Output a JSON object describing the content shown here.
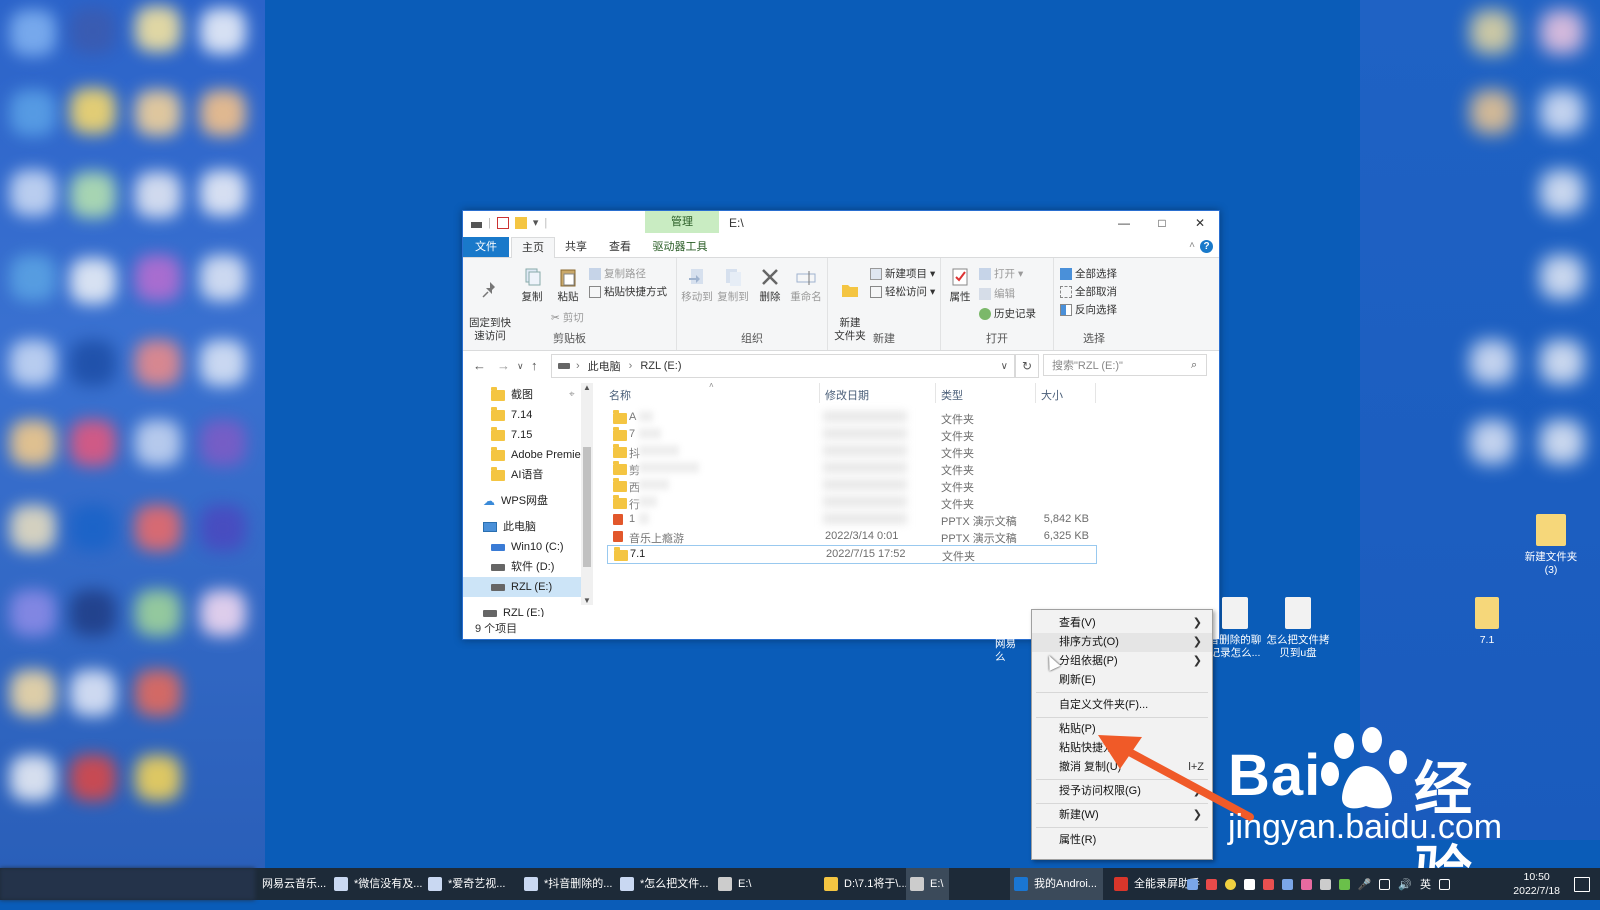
{
  "window": {
    "title": "E:\\",
    "context_tab": "管理",
    "tabs": [
      "文件",
      "主页",
      "共享",
      "查看",
      "驱动器工具"
    ],
    "help_label": "?"
  },
  "ribbon": {
    "clipboard": {
      "label": "剪贴板",
      "pin": "固定到快\n速访问",
      "copy": "复制",
      "paste": "粘贴",
      "copy_path": "复制路径",
      "paste_shortcut": "粘贴快捷方式",
      "cut": "剪切"
    },
    "organize": {
      "label": "组织",
      "move_to": "移动到",
      "copy_to": "复制到",
      "delete": "删除",
      "rename": "重命名"
    },
    "new": {
      "label": "新建",
      "new_folder": "新建\n文件夹",
      "new_item": "新建项目",
      "easy_access": "轻松访问"
    },
    "open": {
      "label": "打开",
      "properties": "属性",
      "open": "打开",
      "edit": "编辑",
      "history": "历史记录"
    },
    "select": {
      "label": "选择",
      "select_all": "全部选择",
      "select_none": "全部取消",
      "invert": "反向选择"
    }
  },
  "address": {
    "crumbs": [
      "此电脑",
      "RZL (E:)"
    ],
    "search_placeholder": "搜索\"RZL (E:)\""
  },
  "nav": {
    "items": [
      {
        "label": "截图",
        "kind": "folder"
      },
      {
        "label": "7.14",
        "kind": "folder"
      },
      {
        "label": "7.15",
        "kind": "folder"
      },
      {
        "label": "Adobe Premier",
        "kind": "folder"
      },
      {
        "label": "AI语音",
        "kind": "folder"
      },
      {
        "label": "WPS网盘",
        "kind": "cloud"
      },
      {
        "label": "此电脑",
        "kind": "pc"
      },
      {
        "label": "Win10 (C:)",
        "kind": "drive"
      },
      {
        "label": "软件 (D:)",
        "kind": "drive"
      },
      {
        "label": "RZL (E:)",
        "kind": "drive"
      },
      {
        "label": "RZL (E:)",
        "kind": "drive"
      }
    ]
  },
  "columns": {
    "name": "名称",
    "date": "修改日期",
    "type": "类型",
    "size": "大小"
  },
  "files": [
    {
      "name": "A",
      "date": "",
      "type": "文件夹",
      "size": "",
      "icon": "folder"
    },
    {
      "name": "7",
      "date": "",
      "type": "文件夹",
      "size": "",
      "icon": "folder"
    },
    {
      "name": "抖",
      "date": "",
      "type": "文件夹",
      "size": "",
      "icon": "folder"
    },
    {
      "name": "剪",
      "date": "",
      "type": "文件夹",
      "size": "",
      "icon": "folder"
    },
    {
      "name": "西",
      "date": "",
      "type": "文件夹",
      "size": "",
      "icon": "folder"
    },
    {
      "name": "行",
      "date": "",
      "type": "文件夹",
      "size": "",
      "icon": "folder"
    },
    {
      "name": "1",
      "date": "",
      "type": "PPTX 演示文稿",
      "size": "5,842 KB",
      "icon": "pptx"
    },
    {
      "name": "音乐上瘾游",
      "date": "2022/3/14 0:01",
      "type": "PPTX 演示文稿",
      "size": "6,325 KB",
      "icon": "pptx"
    },
    {
      "name": "7.1",
      "date": "2022/7/15 17:52",
      "type": "文件夹",
      "size": "",
      "icon": "folder"
    }
  ],
  "status": "9 个项目",
  "desktop_icons": [
    {
      "label": "新建文件夹\n(3)"
    },
    {
      "label": "音删除的聊\n记录怎么..."
    },
    {
      "label": "怎么把文件拷\n贝到u盘"
    },
    {
      "label": "7.1"
    },
    {
      "label": "网易\n么"
    }
  ],
  "context_menu": {
    "items": [
      {
        "label": "查看(V)",
        "submenu": true
      },
      {
        "label": "排序方式(O)",
        "submenu": true
      },
      {
        "label": "分组依据(P)",
        "submenu": true
      },
      {
        "label": "刷新(E)",
        "submenu": false
      },
      {
        "label": "自定义文件夹(F)...",
        "submenu": false
      },
      {
        "label": "粘贴(P)",
        "submenu": false
      },
      {
        "label": "粘贴快捷方",
        "submenu": false
      },
      {
        "label": "撤消 复制(U)",
        "shortcut": "l+Z",
        "submenu": false
      },
      {
        "label": "授予访问权限(G)",
        "submenu": true
      },
      {
        "label": "新建(W)",
        "submenu": true
      },
      {
        "label": "属性(R)",
        "submenu": false
      }
    ]
  },
  "watermark": {
    "brand": "Bai",
    "brand2": "经验",
    "url": "jingyan.baidu.com"
  },
  "taskbar": {
    "items": [
      "网易云音乐...",
      "*微信没有及...",
      "*爱奇艺视...",
      "*抖音删除的...",
      "*怎么把文件...",
      "E:\\",
      "D:\\7.1将于\\...",
      "E:\\",
      "我的Androi...",
      "全能录屏助手"
    ],
    "ime": "英",
    "time": "10:50",
    "date": "2022/7/18"
  },
  "colors": {
    "desktop": "#0a5cb8",
    "accent": "#1979ca",
    "manage_tab": "#c9ecc2",
    "arrow": "#f05a28",
    "taskbar": "#1d2a38"
  }
}
